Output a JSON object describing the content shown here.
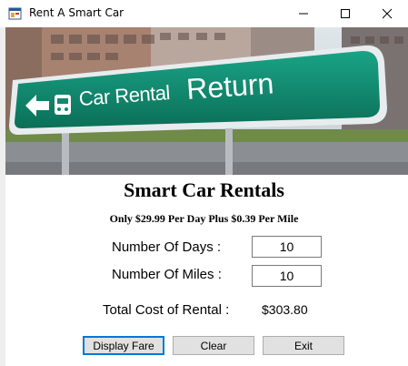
{
  "window": {
    "title": "Rent A Smart Car",
    "icon": "windows-form-icon",
    "controls": [
      "minimize-icon",
      "maximize-icon",
      "close-icon"
    ]
  },
  "banner": {
    "sign_text_car": "Car Rental",
    "sign_text_return": "Return",
    "sign_color": "#0f8a6f"
  },
  "form": {
    "heading": "Smart Car Rentals",
    "subheading": "Only $29.99 Per Day Plus $0.39 Per Mile",
    "days_label": "Number Of Days :",
    "days_value": "10",
    "miles_label": "Number Of Miles :",
    "miles_value": "10",
    "total_label": "Total Cost of Rental :",
    "total_value": "$303.80"
  },
  "buttons": {
    "display": "Display Fare",
    "clear": "Clear",
    "exit": "Exit"
  },
  "colors": {
    "focus_border": "#0078d7",
    "button_face": "#e1e1e1"
  }
}
